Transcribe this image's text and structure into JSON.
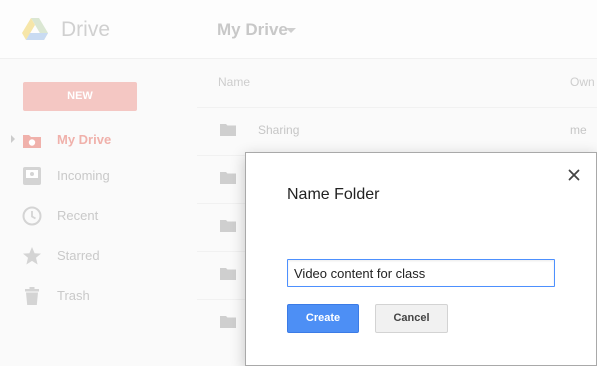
{
  "app": {
    "brand": "Drive",
    "breadcrumb": "My Drive"
  },
  "sidebar": {
    "new_label": "NEW",
    "items": [
      {
        "label": "My Drive",
        "icon": "my-drive-icon",
        "active": true
      },
      {
        "label": "Incoming",
        "icon": "incoming-icon",
        "active": false
      },
      {
        "label": "Recent",
        "icon": "clock-icon",
        "active": false
      },
      {
        "label": "Starred",
        "icon": "star-icon",
        "active": false
      },
      {
        "label": "Trash",
        "icon": "trash-icon",
        "active": false
      }
    ]
  },
  "file_list": {
    "columns": {
      "name": "Name",
      "owner": "Own"
    },
    "rows": [
      {
        "name": "Sharing",
        "owner": "me"
      },
      {
        "name": "",
        "owner": ""
      },
      {
        "name": "",
        "owner": ""
      },
      {
        "name": "",
        "owner": ""
      },
      {
        "name": "",
        "owner": ""
      }
    ]
  },
  "dialog": {
    "title": "Name Folder",
    "input_value": "Video content for class",
    "create_label": "Create",
    "cancel_label": "Cancel"
  },
  "colors": {
    "accent_blue": "#4d8ff5",
    "new_button_faded": "#f4c7c3",
    "active_nav_faded": "#f0b1ab"
  }
}
